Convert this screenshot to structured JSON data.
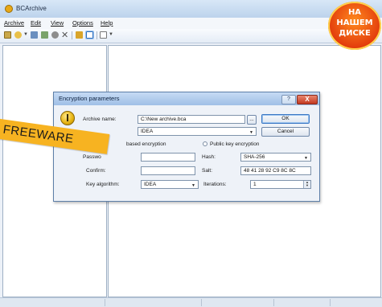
{
  "window": {
    "title": "BCArchive"
  },
  "menu": {
    "items": [
      "Archive",
      "Edit",
      "View",
      "Options",
      "Help"
    ]
  },
  "dialog": {
    "title": "Encryption parameters",
    "help_label": "?",
    "close_label": "X",
    "archive_name_label": "Archive name:",
    "archive_name_value": "C:\\New archive.bca",
    "browse_label": "...",
    "algorithm_value": "IDEA",
    "ok_label": "OK",
    "cancel_label": "Cancel",
    "password_based_label": "based encryption",
    "public_key_label": "Public key encryption",
    "password_label": "Passwo",
    "confirm_label": "Confirm:",
    "key_algorithm_label": "Key algorithm:",
    "key_algorithm_value": "IDEA",
    "hash_label": "Hash:",
    "hash_value": "SHA-256",
    "salt_label": "Salt:",
    "salt_value": "48 41 28 92 C9 8C 8C",
    "iterations_label": "Iterations:",
    "iterations_value": "1"
  },
  "overlays": {
    "freeware_label": "FREEWARE",
    "badge_lines": [
      "НА",
      "НАШЕМ",
      "ДИСКЕ"
    ]
  }
}
